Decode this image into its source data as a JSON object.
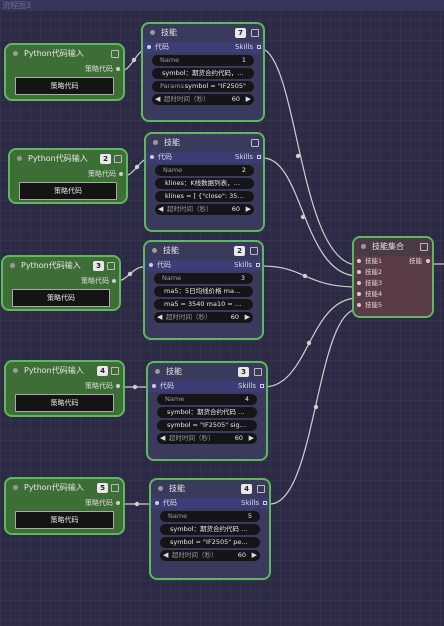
{
  "canvas": {
    "title": "流程图3"
  },
  "python_nodes": [
    {
      "title": "Python代码输入",
      "badge": "",
      "output_label": "策略代码",
      "code_label": "策略代码"
    },
    {
      "title": "Python代码输入",
      "badge": "2",
      "output_label": "策略代码",
      "code_label": "策略代码"
    },
    {
      "title": "Python代码输入",
      "badge": "3",
      "output_label": "策略代码",
      "code_label": "策略代码"
    },
    {
      "title": "Python代码输入",
      "badge": "4",
      "output_label": "策略代码",
      "code_label": "策略代码"
    },
    {
      "title": "Python代码输入",
      "badge": "5",
      "output_label": "策略代码",
      "code_label": "策略代码"
    }
  ],
  "skill_nodes": [
    {
      "title": "技能",
      "badge": "7",
      "port_in": "代码",
      "port_out": "Skills",
      "name_label": "Name",
      "name_value": "1",
      "field2": "symbol：期货合约代码，...",
      "params_label": "Params",
      "params_value": "symbol = \"IF2505\"",
      "timeout_label": "超时时间（秒）",
      "timeout_value": "60"
    },
    {
      "title": "技能",
      "badge": "",
      "port_in": "代码",
      "port_out": "Skills",
      "name_label": "Name",
      "name_value": "2",
      "field2": "klines：K线数据列表，用 ...",
      "field3": "klines = [   {\"close\": 3500 ...",
      "timeout_label": "超时时间（秒）",
      "timeout_value": "60"
    },
    {
      "title": "技能",
      "badge": "2",
      "port_in": "代码",
      "port_out": "Skills",
      "name_label": "Name",
      "name_value": "3",
      "field2": "ma5：5日均线价格 ma10 ...",
      "field3": "ma5 = 3540 ma10 = 3510 ...",
      "timeout_label": "超时时间（秒）",
      "timeout_value": "60"
    },
    {
      "title": "技能",
      "badge": "3",
      "port_in": "代码",
      "port_out": "Skills",
      "name_label": "Name",
      "name_value": "4",
      "field2": "symbol：期货合约代码 sig...",
      "field3": "symbol = \"IF2505\" signal ...",
      "timeout_label": "超时时间（秒）",
      "timeout_value": "60"
    },
    {
      "title": "技能",
      "badge": "4",
      "port_in": "代码",
      "port_out": "Skills",
      "name_label": "Name",
      "name_value": "5",
      "field2": "symbol：期货合约代码 pe ...",
      "field3": "symbol = \"IF2505\" period ...",
      "timeout_label": "超时时间（秒）",
      "timeout_value": "60"
    }
  ],
  "group_node": {
    "title": "技能集合",
    "out_label": "技能",
    "inputs": [
      "技能1",
      "技能2",
      "技能3",
      "技能4",
      "技能5"
    ]
  },
  "colors": {
    "node_border": "#5fb85f",
    "wire": "#cfcfcf",
    "python_bg": "#3d6e35",
    "skill_bg": "#3a3a5c",
    "group_bg": "#5a3c46"
  }
}
